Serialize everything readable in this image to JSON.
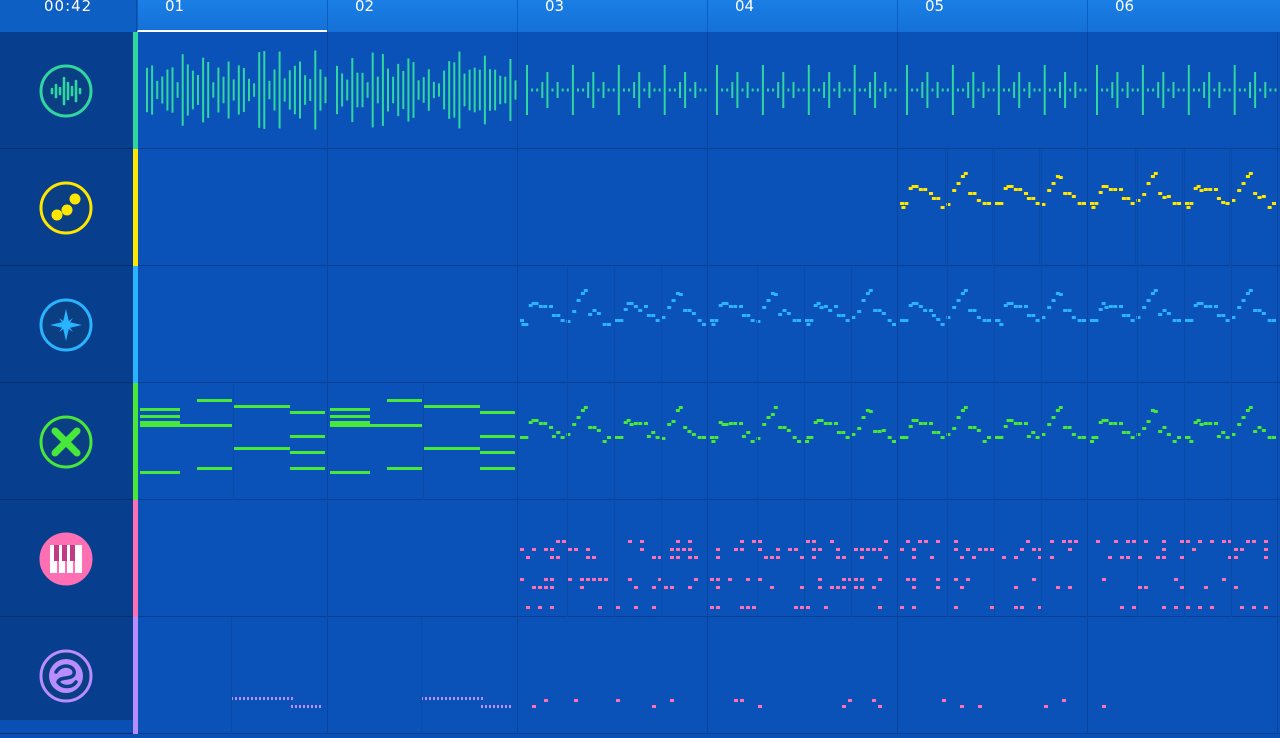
{
  "header": {
    "time": "00:42",
    "bars": [
      "01",
      "02",
      "03",
      "04",
      "05",
      "06"
    ],
    "active_bar": 0
  },
  "tracks": [
    {
      "icon": "waveform-icon",
      "color": "#2fd6a0"
    },
    {
      "icon": "dots-icon",
      "color": "#ffe600"
    },
    {
      "icon": "star-icon",
      "color": "#2ab4ff"
    },
    {
      "icon": "x-icon",
      "color": "#47e83a"
    },
    {
      "icon": "piano-icon",
      "color": "#ff6fb3"
    },
    {
      "icon": "swirl-icon",
      "color": "#b98cff"
    }
  ]
}
